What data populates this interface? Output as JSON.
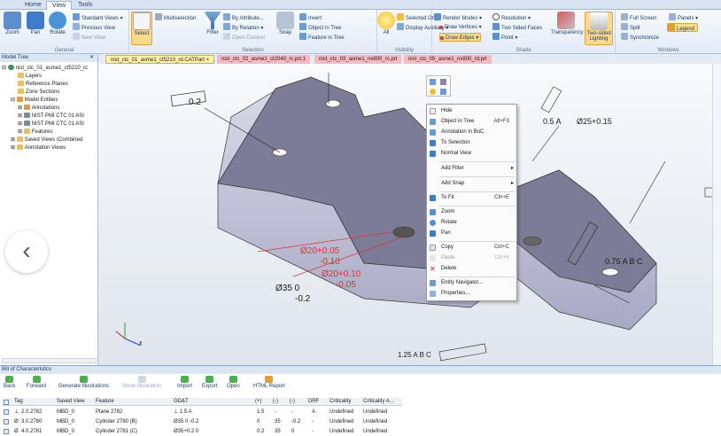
{
  "ribbon_tabs": [
    "Home",
    "View",
    "Tools"
  ],
  "ribbon": {
    "general": {
      "label": "General",
      "zoom": "Zoom",
      "pan": "Pan",
      "rotate": "Rotate",
      "standard_views": "Standard Views",
      "previous_view": "Previous View",
      "next_view": "Next View"
    },
    "selection": {
      "label": "Selection",
      "select": "Select",
      "multiselection": "Multiselection",
      "filter": "Filter",
      "by_attribute": "By Attribute...",
      "by_relation": "By Relation",
      "open_context": "Open Context",
      "snap": "Snap",
      "invert": "Invert",
      "object_in_tree": "Object in Tree",
      "feature_in_tree": "Feature in Tree"
    },
    "visibility": {
      "label": "Visibility",
      "all": "All",
      "selected_only": "Selected Only",
      "display_auxiliary": "Display Auxiliary"
    },
    "shade": {
      "label": "Shade",
      "render_modes": "Render Modes",
      "draw_vertices": "Draw Vertices",
      "draw_edges": "Draw Edges",
      "resolution": "Resolution",
      "two_sided_faces": "Two Sided Faces",
      "point": "Point",
      "transparency": "Transparency",
      "two_sided_lighting": "Two-sided Lighting"
    },
    "windows": {
      "label": "Windows",
      "full_screen": "Full Screen",
      "split": "Split",
      "synchronize": "Synchronize",
      "panels": "Panels",
      "legend": "Legend"
    }
  },
  "model_tree": {
    "title": "Model Tree",
    "items": [
      "nist_ctc_01_asme1_ct5210_rc",
      "Layers",
      "Reference Planes",
      "Zone Sections",
      "Model Entities",
      "Annotations",
      "NIST PMI CTC 01 ASI",
      "NIST PMI CTC 01 ASI",
      "Features",
      "Saved Views (Combined",
      "Annotation Views"
    ]
  },
  "doc_tabs": [
    "nist_ctc_01_asme1_ct5210_rd.CATPart",
    "nist_ctc_02_asme1_ct2040_rc.prt.1",
    "nist_ctc_03_asme1_nx800_rc.prt",
    "nist_ctc_05_asme1_nx800_rd.prt"
  ],
  "viewport_annotations": {
    "a1": "0.2",
    "a2": "Ø20+0.05",
    "a3": "-0.10",
    "a4": "Ø20+0.10",
    "a5": "-0.05",
    "a6": "Ø35 0",
    "a7": "-0.2",
    "a8": "0.5 A",
    "a9": "Ø25+0.15",
    "a10": "0.75 A B C",
    "a11": "1.25 A B C",
    "axis_x": "x"
  },
  "context_menu": [
    {
      "label": "Hide",
      "shortcut": "",
      "icon": "hide-icon"
    },
    {
      "label": "Object in Tree",
      "shortcut": "Alt+F3",
      "icon": "object-in-tree-icon"
    },
    {
      "label": "Annotation in BoC",
      "shortcut": "",
      "icon": "annotation-icon"
    },
    {
      "label": "To Selection",
      "shortcut": "",
      "icon": "to-selection-icon"
    },
    {
      "label": "Normal View",
      "shortcut": "",
      "icon": "normal-view-icon"
    },
    {
      "label": "Add Filter",
      "shortcut": "",
      "icon": ""
    },
    {
      "label": "Add Snap",
      "shortcut": "",
      "icon": ""
    },
    {
      "label": "To Fit",
      "shortcut": "Ctrl+E",
      "icon": "to-fit-icon"
    },
    {
      "label": "Zoom",
      "shortcut": "",
      "icon": "zoom-icon"
    },
    {
      "label": "Rotate",
      "shortcut": "",
      "icon": "rotate-icon"
    },
    {
      "label": "Pan",
      "shortcut": "",
      "icon": "pan-icon"
    },
    {
      "label": "Copy",
      "shortcut": "Ctrl+C",
      "icon": "copy-icon"
    },
    {
      "label": "Paste",
      "shortcut": "Ctrl+V",
      "icon": "paste-icon"
    },
    {
      "label": "Delete",
      "shortcut": "",
      "icon": "delete-icon"
    },
    {
      "label": "Entity Navigator...",
      "shortcut": "",
      "icon": "navigator-icon"
    },
    {
      "label": "Properties...",
      "shortcut": "",
      "icon": "properties-icon"
    }
  ],
  "boc": {
    "title": "Bill of Characteristics",
    "buttons": [
      "Back",
      "Forward",
      "Generate Illustrations",
      "Show Illustration",
      "Import",
      "Export",
      "Open",
      "HTML Report"
    ],
    "columns": [
      "Tag",
      "Saved View",
      "Feature",
      "GD&T",
      "(+)",
      "(-)",
      "(-)",
      "DRF",
      "Criticality",
      "Criticality A..."
    ],
    "rows": [
      [
        "2.0.2782",
        "MBD_0",
        "Plane 2782",
        "⊥ 1.5 A",
        "1.5",
        "-",
        "-",
        "A",
        "Undefined",
        "Undefined"
      ],
      [
        "3.0.2780",
        "MBD_0",
        "Cylinder 2780 (B)",
        "Ø35 0 -0.2",
        "0",
        "35",
        "-0.2",
        "-",
        "Undefined",
        "Undefined"
      ],
      [
        "4.0.2781",
        "MBD_0",
        "Cylinder 2781 (C)",
        "Ø35+0.2 0",
        "0.2",
        "35",
        "0",
        "-",
        "Undefined",
        "Undefined"
      ]
    ],
    "row_symbols": [
      "⊥",
      "Ø",
      "Ø"
    ]
  },
  "colors": {
    "ribbon_bg": "#e2ebf6",
    "part_face": "#7f7f98",
    "selection_red": "#e03030",
    "accent": "#1e3c66"
  }
}
